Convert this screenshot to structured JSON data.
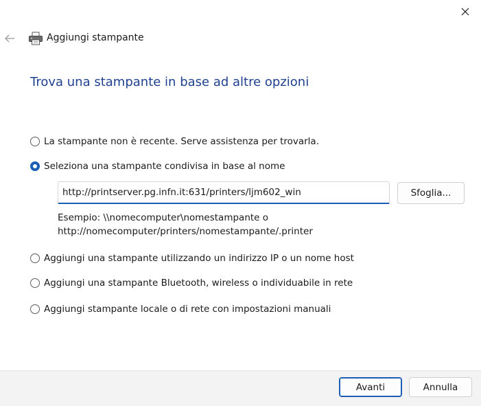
{
  "window": {
    "close_label": "Close"
  },
  "header": {
    "title": "Aggiungi stampante",
    "back_icon": "back-arrow-icon",
    "printer_icon": "printer-icon"
  },
  "page": {
    "title": "Trova una stampante in base ad altre opzioni"
  },
  "options": [
    {
      "label": "La stampante non è recente. Serve assistenza per trovarla.",
      "checked": false
    },
    {
      "label": "Seleziona una stampante condivisa in base al nome",
      "checked": true
    },
    {
      "label": "Aggiungi una stampante utilizzando un indirizzo IP o un nome host",
      "checked": false
    },
    {
      "label": "Aggiungi una stampante Bluetooth, wireless o individuabile in rete",
      "checked": false
    },
    {
      "label": "Aggiungi stampante locale o di rete con impostazioni manuali",
      "checked": false
    }
  ],
  "shared_printer": {
    "value": "http://printserver.pg.infn.it:631/printers/ljm602_win",
    "browse_label": "Sfoglia...",
    "example_line1": "Esempio: \\\\nomecomputer\\nomestampante o",
    "example_line2": "http://nomecomputer/printers/nomestampante/.printer"
  },
  "footer": {
    "next_label": "Avanti",
    "cancel_label": "Annulla"
  },
  "colors": {
    "accent": "#1a5fb4",
    "title": "#1f3f8f",
    "footer_bg": "#f3f3f3"
  }
}
